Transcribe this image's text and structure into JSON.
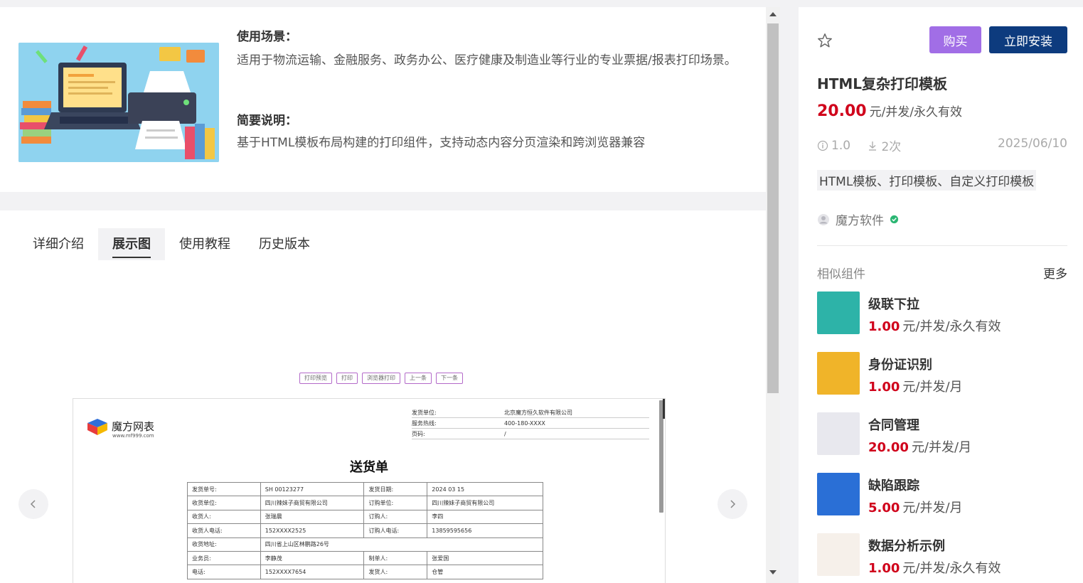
{
  "product": {
    "scene_title": "使用场景：",
    "scene_text": "适用于物流运输、金融服务、政务办公、医疗健康及制造业等行业的专业票据/报表打印场景。",
    "brief_title": "简要说明：",
    "brief_text": "基于HTML模板布局构建的打印组件，支持动态内容分页渲染和跨浏览器兼容"
  },
  "tabs": [
    {
      "label": "详细介绍",
      "active": false
    },
    {
      "label": "展示图",
      "active": true
    },
    {
      "label": "使用教程",
      "active": false
    },
    {
      "label": "历史版本",
      "active": false
    }
  ],
  "preview": {
    "toolbar": [
      "打印预览",
      "打印",
      "浏览器打印",
      "上一条",
      "下一条"
    ],
    "brand": "魔方网表",
    "url": "www.mf999.com",
    "info": [
      {
        "k": "发货单位:",
        "v": "北京魔方恒久软件有限公司"
      },
      {
        "k": "服务热线:",
        "v": "400-180-XXXX"
      },
      {
        "k": "页码:",
        "v": "/"
      }
    ],
    "title": "送货单",
    "table": [
      [
        "发货单号:",
        "SH 00123277",
        "发货日期:",
        "2024 03 15"
      ],
      [
        "收货单位:",
        "四川辣妹子商贸有限公司",
        "订购单位:",
        "四川辣妹子商贸有限公司"
      ],
      [
        "收货人:",
        "张瑞晨",
        "订购人:",
        "李四"
      ],
      [
        "收货人电话:",
        "152XXXX2525",
        "订购人电话:",
        "13859595656"
      ],
      [
        "收货地址:",
        "四川省上山区林鹏路26号",
        "",
        ""
      ],
      [
        "业务员:",
        "李静茂",
        "制单人:",
        "张爱国"
      ],
      [
        "电话:",
        "152XXXX7654",
        "发货人:",
        "仓管"
      ]
    ]
  },
  "sidebar": {
    "buy_label": "购买",
    "install_label": "立即安装",
    "name": "HTML复杂打印模板",
    "price": "20.00",
    "price_unit": "元/并发/永久有效",
    "version": "1.0",
    "downloads": "2次",
    "date": "2025/06/10",
    "tags": "HTML模板、打印模板、自定义打印模板",
    "author": "魔方软件",
    "similar_title": "相似组件",
    "more_label": "更多",
    "similar": [
      {
        "name": "级联下拉",
        "price": "1.00",
        "unit": "元/并发/永久有效",
        "color": "#2db3a8"
      },
      {
        "name": "身份证识别",
        "price": "1.00",
        "unit": "元/并发/月",
        "color": "#f0b429"
      },
      {
        "name": "合同管理",
        "price": "20.00",
        "unit": "元/并发/月",
        "color": "#e8e8ee"
      },
      {
        "name": "缺陷跟踪",
        "price": "5.00",
        "unit": "元/并发/月",
        "color": "#2a6fd6"
      },
      {
        "name": "数据分析示例",
        "price": "1.00",
        "unit": "元/并发/永久有效",
        "color": "#f6f0ea"
      }
    ]
  },
  "colors": {
    "accent_purple": "#a16ee6",
    "accent_navy": "#0d3b7e",
    "price_red": "#d0021b"
  }
}
